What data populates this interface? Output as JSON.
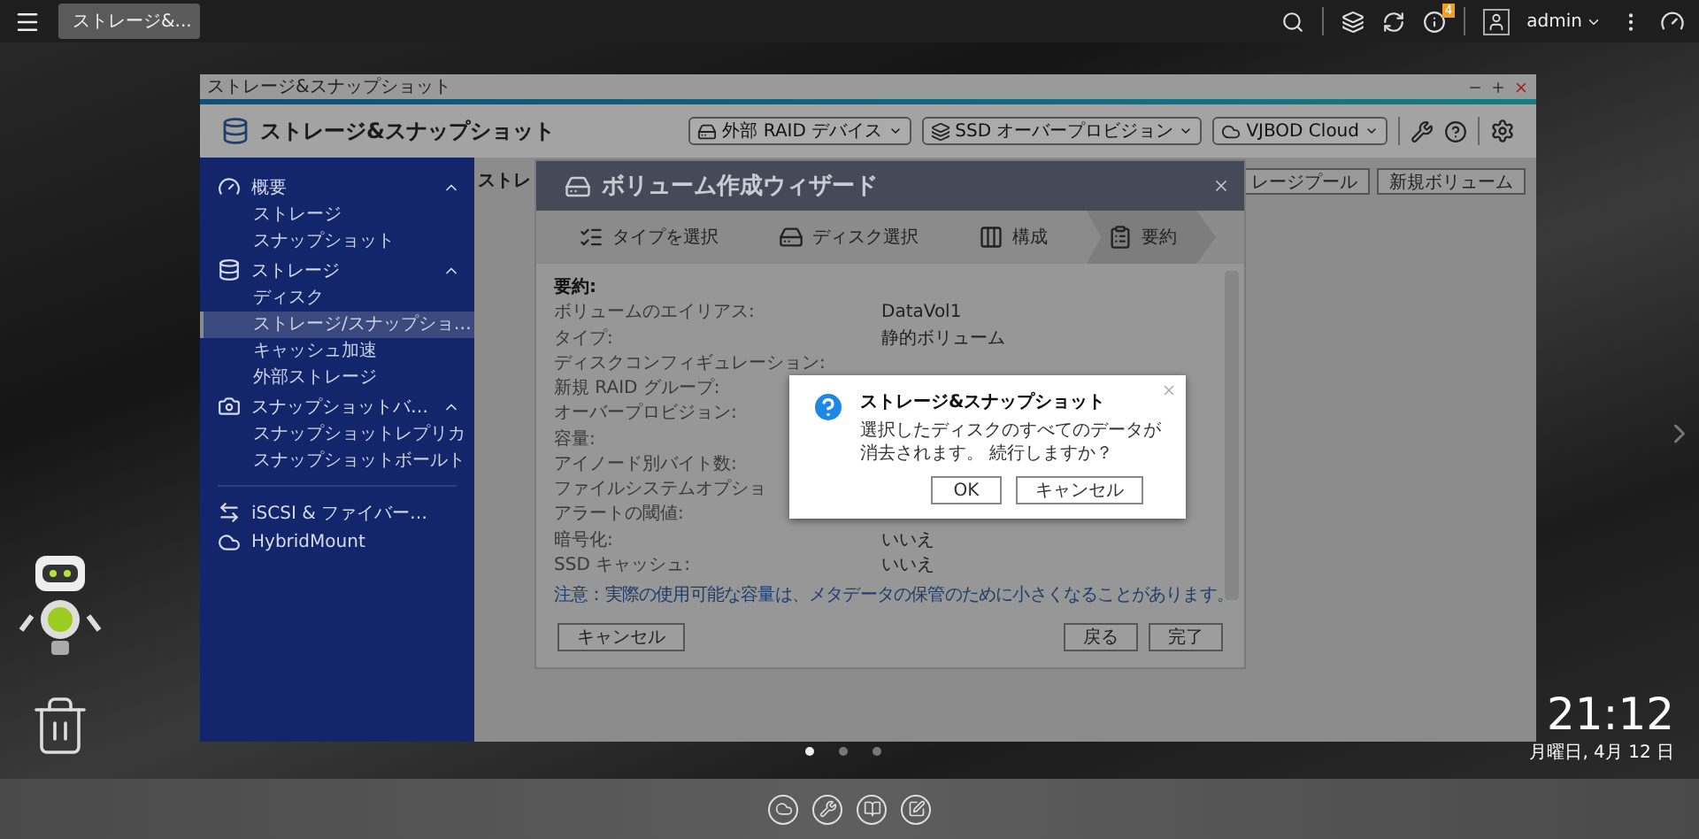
{
  "top_bar": {
    "tab": {
      "label": "ストレージ&...",
      "selected": true
    },
    "notification_count": "4",
    "user": "admin"
  },
  "window": {
    "title": "ストレージ&スナップショット",
    "app_name": "ストレージ&スナップショット",
    "toolbar_buttons": [
      {
        "kind": "drive",
        "label": "外部 RAID デバイス"
      },
      {
        "kind": "ssd",
        "label": "SSD オーバープロビジョン"
      },
      {
        "kind": "cloud",
        "label": "VJBOD Cloud"
      }
    ],
    "sidebar": [
      {
        "kind": "overview",
        "label": "概要",
        "expanded": true,
        "children": [
          {
            "label": "ストレージ",
            "selected": false
          },
          {
            "label": "スナップショット",
            "selected": false
          }
        ]
      },
      {
        "kind": "storage",
        "label": "ストレージ",
        "expanded": true,
        "children": [
          {
            "label": "ディスク",
            "selected": false
          },
          {
            "label": "ストレージ/スナップショ…",
            "selected": true
          },
          {
            "label": "キャッシュ加速",
            "selected": false
          },
          {
            "label": "外部ストレージ",
            "selected": false
          }
        ]
      },
      {
        "kind": "snapshot",
        "label": "スナップショットバ…",
        "expanded": true,
        "children": [
          {
            "label": "スナップショットレプリカ",
            "selected": false
          },
          {
            "label": "スナップショットボールト",
            "selected": false
          }
        ]
      },
      {
        "kind": "iscsi",
        "label": "iSCSI & ファイバー…",
        "divider_before": true
      },
      {
        "kind": "hybrid",
        "label": "HybridMount"
      }
    ],
    "content": {
      "title": "ストレ",
      "buttons": [
        "レージプール",
        "新規ボリューム"
      ]
    }
  },
  "wizard": {
    "title": "ボリューム作成ウィザード",
    "steps": [
      {
        "kind": "type",
        "label": "タイプを選択",
        "selected": false
      },
      {
        "kind": "disk",
        "label": "ディスク選択",
        "selected": false
      },
      {
        "kind": "config",
        "label": "構成",
        "selected": false
      },
      {
        "kind": "summary",
        "label": "要約",
        "selected": true
      }
    ],
    "summary_heading": "要約:",
    "rows": [
      {
        "label": "ボリュームのエイリアス:",
        "value": "DataVol1"
      },
      {
        "label": "タイプ:",
        "value": "静的ボリューム"
      },
      {
        "label": "ディスクコンフィギュレーション:"
      },
      {
        "label": "新規 RAID グループ:"
      },
      {
        "label": "オーバープロビジョン:"
      },
      {
        "label": "容量:"
      },
      {
        "label": "アイノード別バイト数:"
      },
      {
        "label": "ファイルシステムオプショ"
      },
      {
        "label": "アラートの閾値:"
      },
      {
        "label": "暗号化:",
        "value": "いいえ"
      },
      {
        "label": "SSD キャッシュ:",
        "value": "いいえ"
      }
    ],
    "note": "注意：実際の使用可能な容量は、メタデータの保管のために小さくなることがあります。",
    "cancel": "キャンセル",
    "back": "戻る",
    "finish": "完了"
  },
  "dialog": {
    "title": "ストレージ&スナップショット",
    "message": "選択したディスクのすべてのデータが消去されます。 続行しますか？",
    "buttons": [
      "OK",
      "キャンセル"
    ]
  },
  "desktop": {
    "pages": [
      {
        "selected": true
      },
      {
        "selected": false
      },
      {
        "selected": false
      }
    ],
    "time": "21:12",
    "date": "月曜日, 4月 12 日"
  }
}
